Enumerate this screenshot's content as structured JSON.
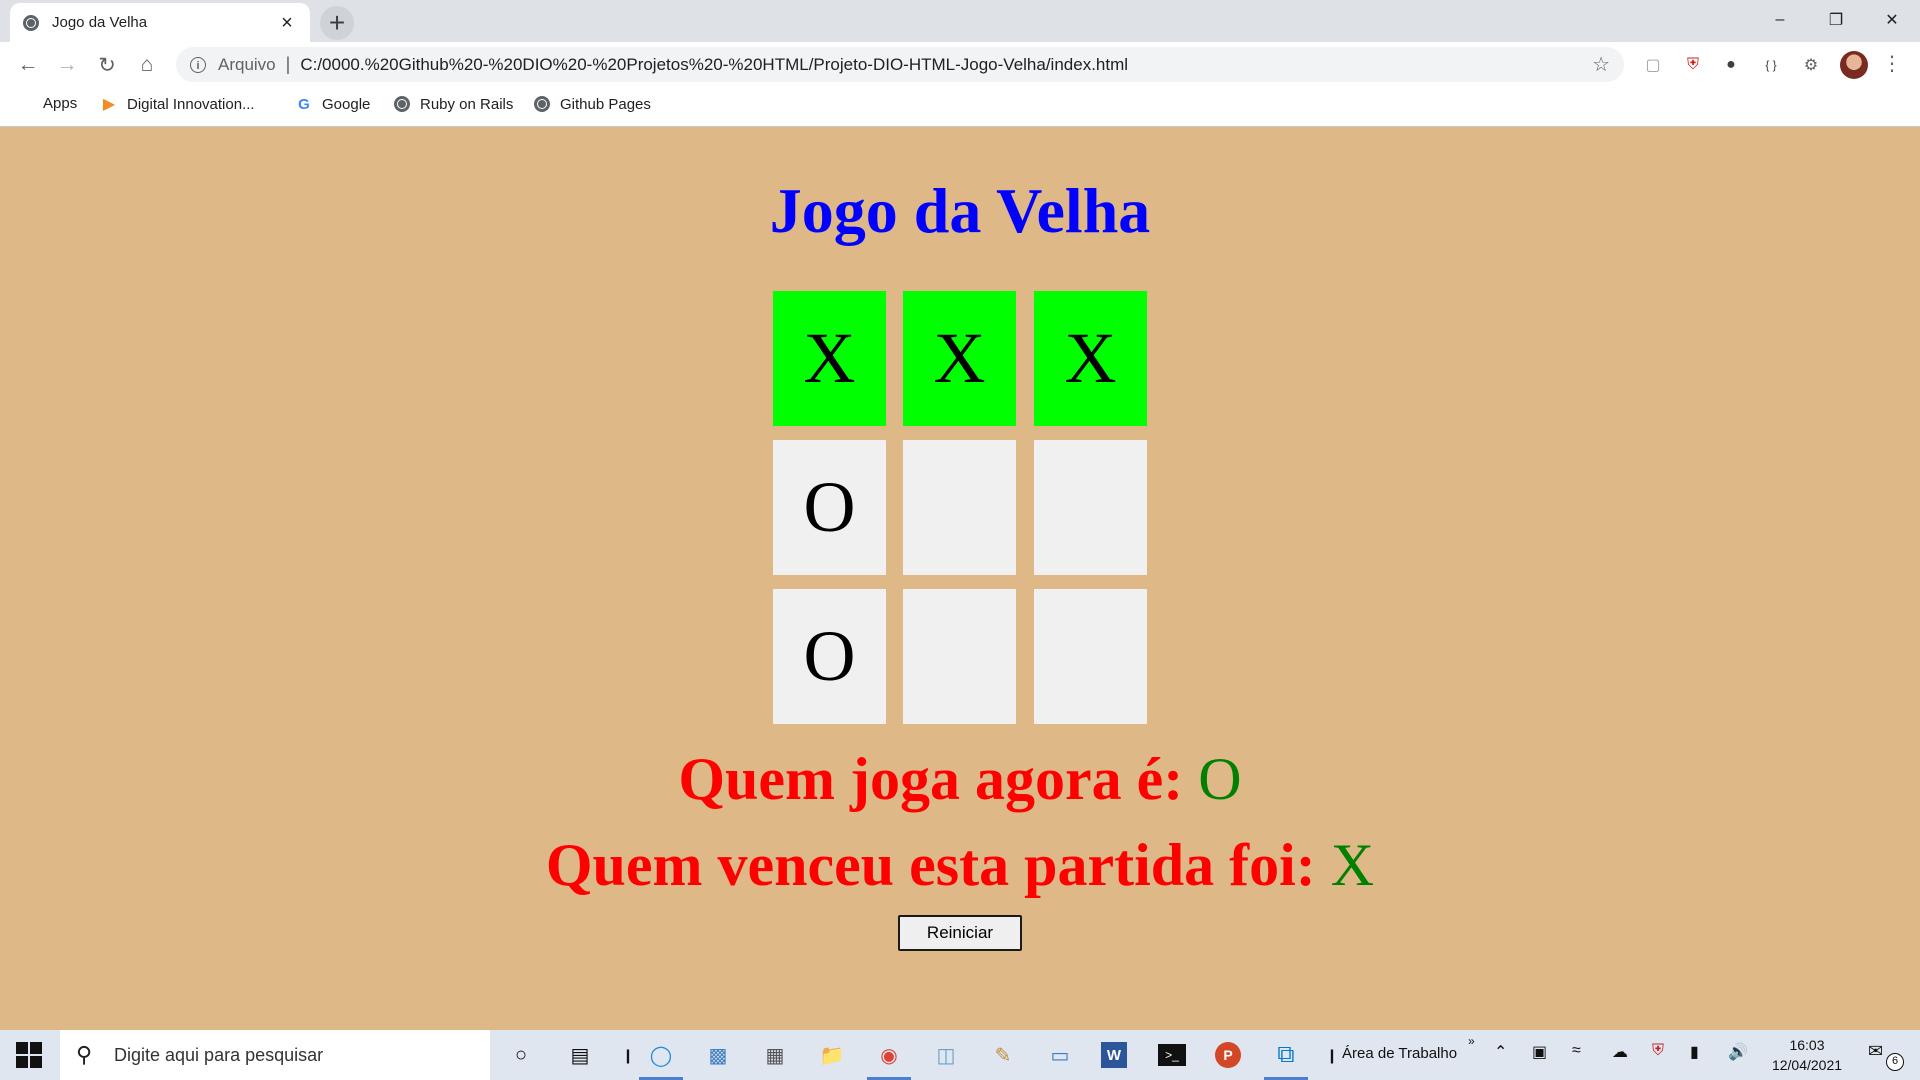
{
  "browser": {
    "tab_title": "Jogo da Velha",
    "tab_close": "×",
    "new_tab": "+",
    "window_controls": [
      "–",
      "❐",
      "✕"
    ],
    "address": {
      "scheme_label": "Arquivo",
      "separator": "|",
      "url": "C:/0000.%20Github%20-%20DIO%20-%20Projetos%20-%20HTML/Projeto-DIO-HTML-Jogo-Velha/index.html"
    },
    "bookmarks": [
      {
        "label": "Apps",
        "icon": "apps-grid-icon"
      },
      {
        "label": "Digital Innovation...",
        "icon": "dio-icon"
      },
      {
        "label": "Google",
        "icon": "google-icon"
      },
      {
        "label": "Ruby on Rails",
        "icon": "globe-icon"
      },
      {
        "label": "Github Pages",
        "icon": "globe-icon"
      }
    ]
  },
  "game": {
    "title": "Jogo da Velha",
    "board": [
      {
        "value": "X",
        "winning": true
      },
      {
        "value": "X",
        "winning": true
      },
      {
        "value": "X",
        "winning": true
      },
      {
        "value": "O",
        "winning": false
      },
      {
        "value": "",
        "winning": false
      },
      {
        "value": "",
        "winning": false
      },
      {
        "value": "O",
        "winning": false
      },
      {
        "value": "",
        "winning": false
      },
      {
        "value": "",
        "winning": false
      }
    ],
    "current_player_label": "Quem joga agora é:",
    "current_player": "O",
    "winner_label": "Quem venceu esta partida foi:",
    "winner": "X",
    "restart_label": "Reiniciar"
  },
  "colors": {
    "page_background": "#deb887",
    "title": "#0000ff",
    "winning_cell": "#00ff00",
    "empty_cell": "#f0f0f0",
    "status_text": "#ff0000",
    "status_value": "#008000"
  },
  "taskbar": {
    "search_placeholder": "Digite aqui para pesquisar",
    "desktop_label": "Área de Trabalho",
    "time": "16:03",
    "date": "12/04/2021",
    "notification_count": "6"
  }
}
